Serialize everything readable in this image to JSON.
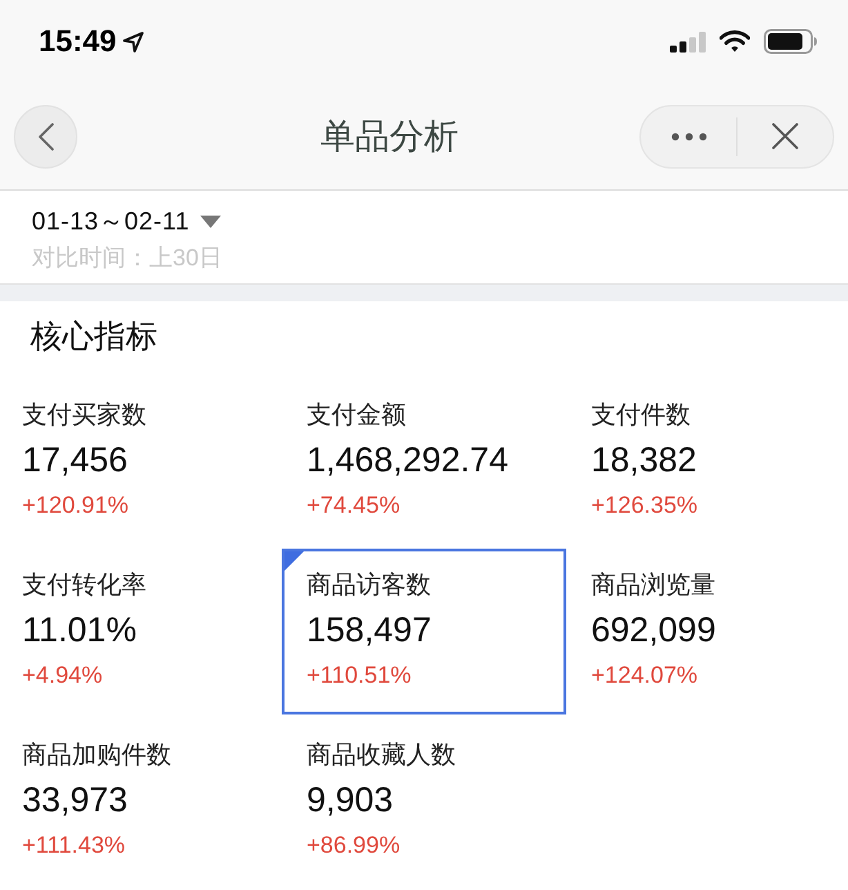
{
  "status_bar": {
    "time": "15:49"
  },
  "nav_bar": {
    "title": "单品分析"
  },
  "date_filter": {
    "range": "01-13～02-11",
    "comparison": "对比时间：上30日"
  },
  "section": {
    "title": "核心指标"
  },
  "metrics": [
    {
      "label": "支付买家数",
      "value": "17,456",
      "change": "+120.91%",
      "selected": false
    },
    {
      "label": "支付金额",
      "value": "1,468,292.74",
      "change": "+74.45%",
      "selected": false
    },
    {
      "label": "支付件数",
      "value": "18,382",
      "change": "+126.35%",
      "selected": false
    },
    {
      "label": "支付转化率",
      "value": "11.01%",
      "change": "+4.94%",
      "selected": false
    },
    {
      "label": "商品访客数",
      "value": "158,497",
      "change": "+110.51%",
      "selected": true
    },
    {
      "label": "商品浏览量",
      "value": "692,099",
      "change": "+124.07%",
      "selected": false
    },
    {
      "label": "商品加购件数",
      "value": "33,973",
      "change": "+111.43%",
      "selected": false
    },
    {
      "label": "商品收藏人数",
      "value": "9,903",
      "change": "+86.99%",
      "selected": false
    }
  ]
}
